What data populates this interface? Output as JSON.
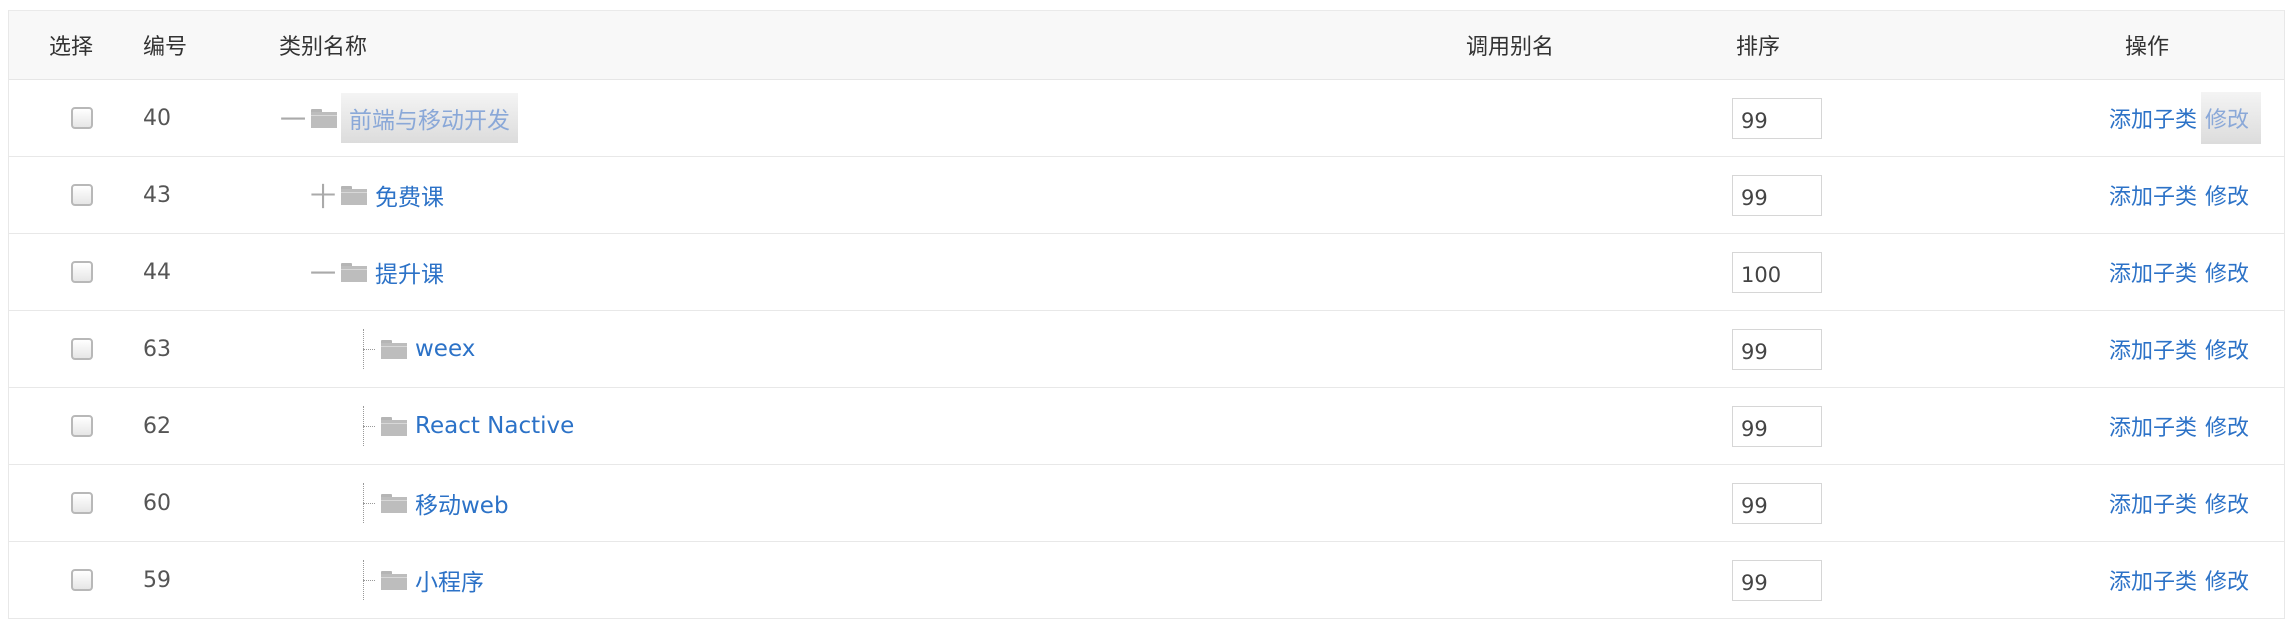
{
  "table": {
    "headers": {
      "select": "选择",
      "id": "编号",
      "name": "类别名称",
      "alias": "调用别名",
      "sort": "排序",
      "ops": "操作"
    },
    "add_child_label": "添加子类",
    "edit_label": "修改",
    "rows": [
      {
        "id": "40",
        "name": "前端与移动开发",
        "sort": "99",
        "toggle": "一"
      },
      {
        "id": "43",
        "name": "免费课",
        "sort": "99",
        "toggle": "十"
      },
      {
        "id": "44",
        "name": "提升课",
        "sort": "100",
        "toggle": "一"
      },
      {
        "id": "63",
        "name": "weex",
        "sort": "99"
      },
      {
        "id": "62",
        "name": "React Nactive",
        "sort": "99"
      },
      {
        "id": "60",
        "name": "移动web",
        "sort": "99"
      },
      {
        "id": "59",
        "name": "小程序",
        "sort": "99"
      }
    ]
  }
}
